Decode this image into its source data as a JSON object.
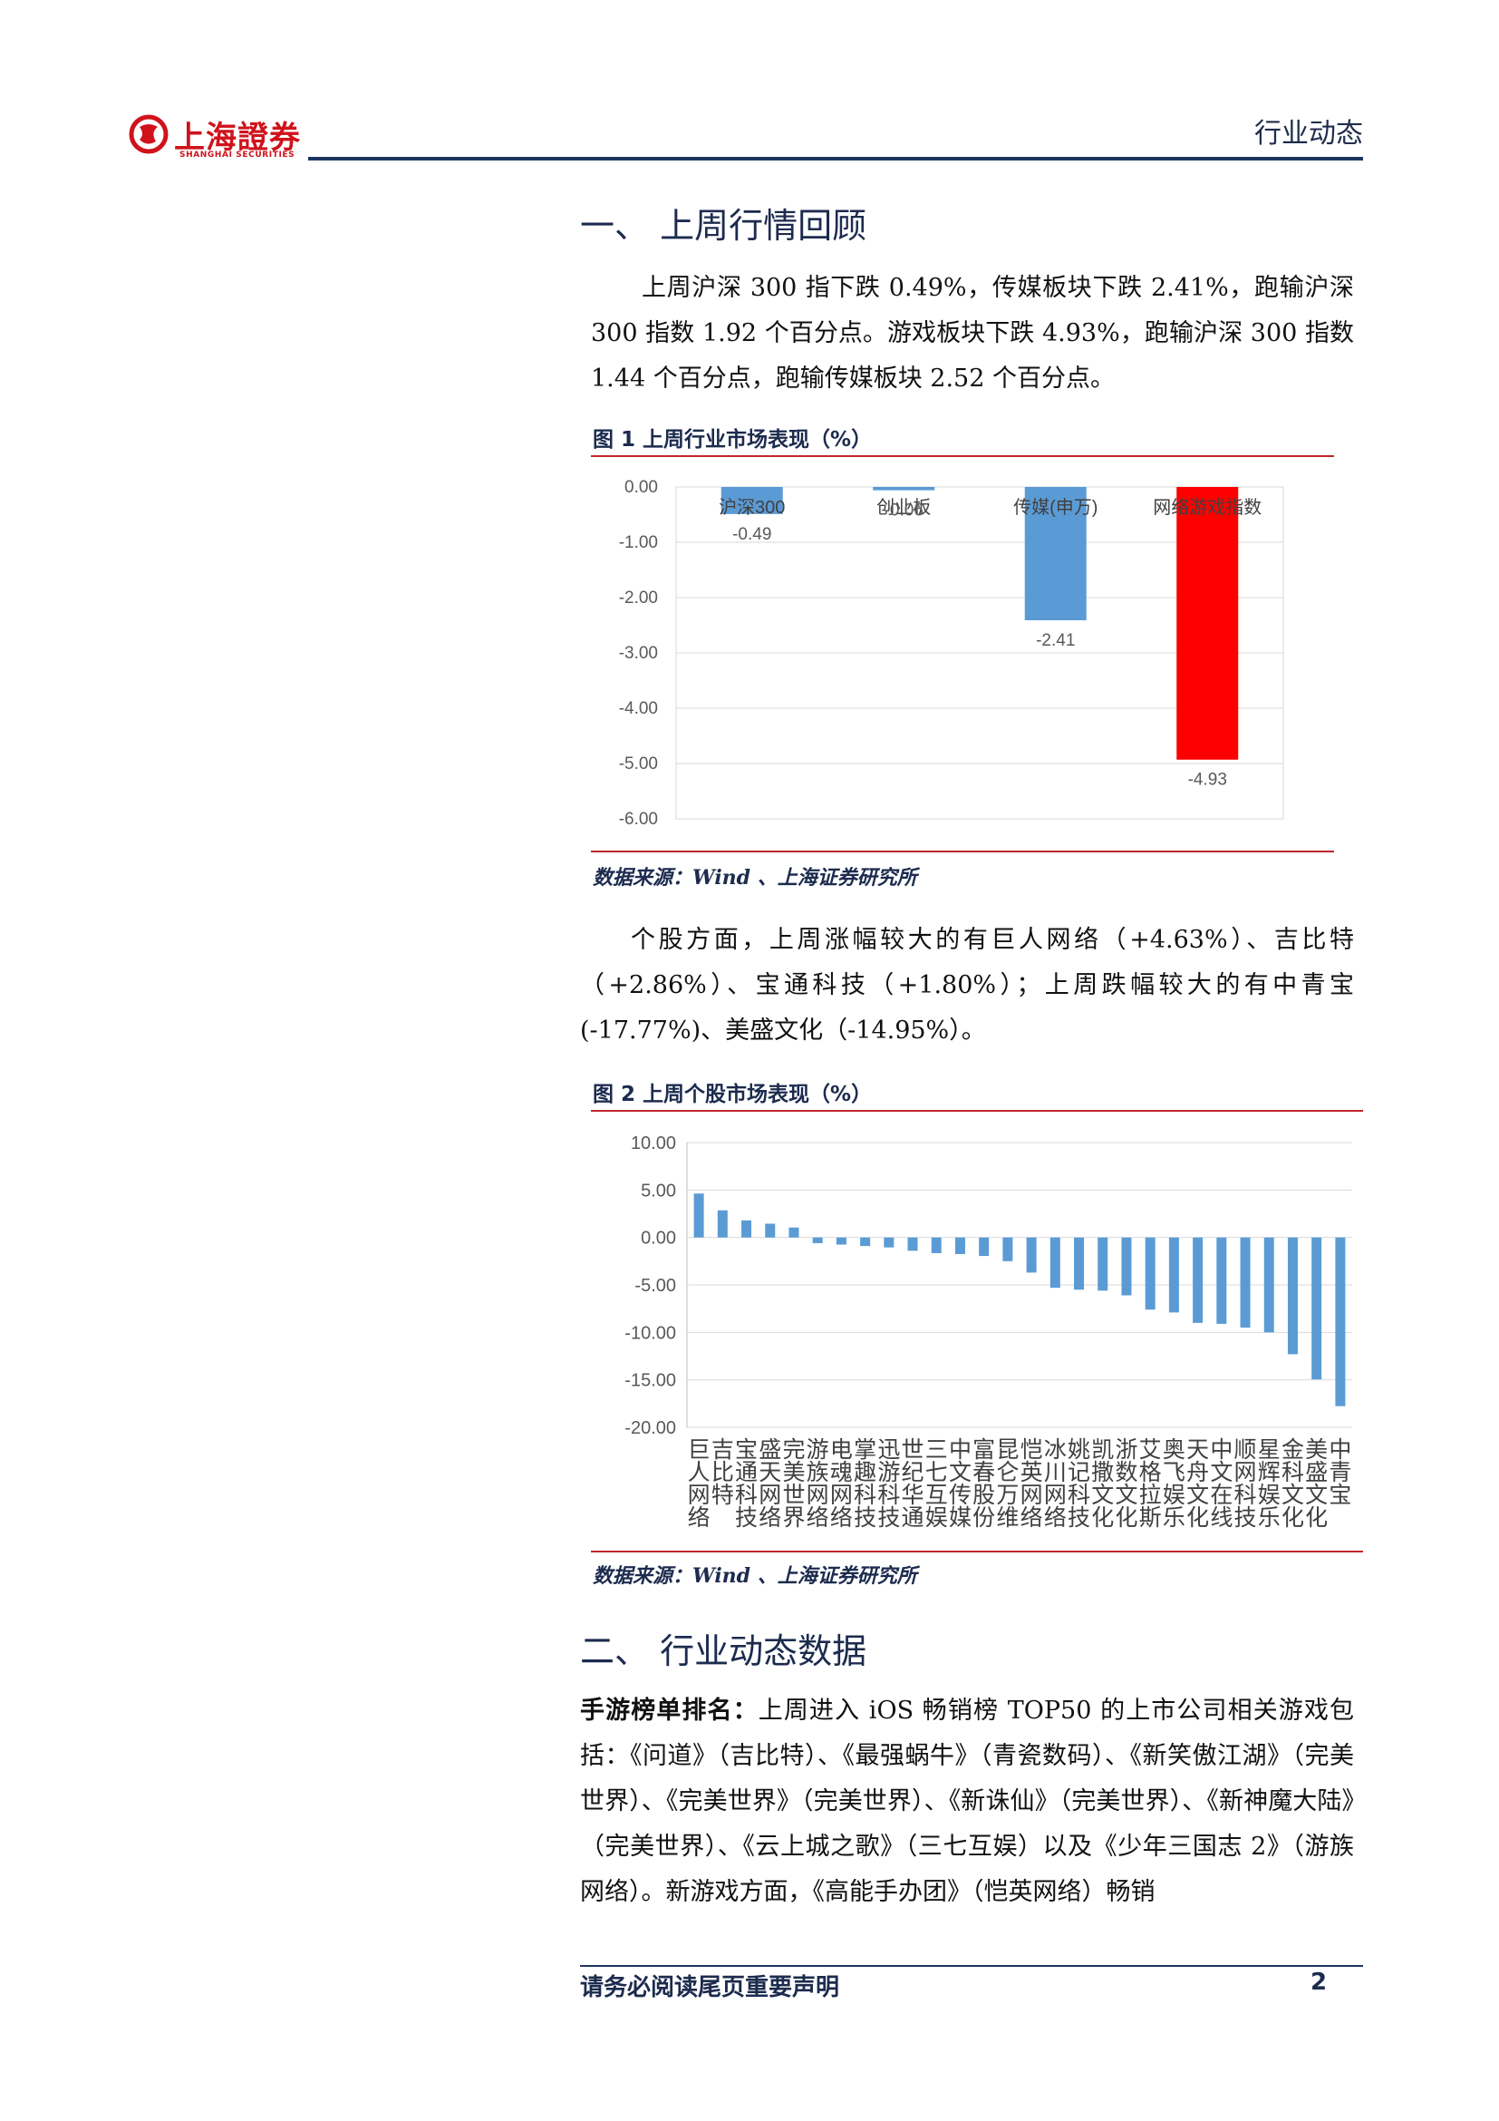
{
  "header": {
    "logo_cn": "上海證券",
    "logo_en": "SHANGHAI SECURITIES",
    "section_label": "行业动态"
  },
  "section1": {
    "title": "一、 上周行情回顾",
    "paragraph1": "上周沪深 300 指下跌 0.49%，传媒板块下跌 2.41%，跑输沪深 300 指数 1.92 个百分点。游戏板块下跌 4.93%，跑输沪深 300 指数 1.44 个百分点，跑输传媒板块 2.52 个百分点。",
    "fig1_title": "图 1 上周行业市场表现（%）",
    "fig1_source": "数据来源：Wind 、上海证券研究所",
    "paragraph2": "个股方面，上周涨幅较大的有巨人网络（+4.63%）、吉比特（+2.86%）、宝通科技（+1.80%）；上周跌幅较大的有中青宝(-17.77%)、美盛文化（-14.95%）。",
    "fig2_title": "图 2 上周个股市场表现（%）",
    "fig2_source": "数据来源：Wind 、上海证券研究所"
  },
  "section2": {
    "title": "二、 行业动态数据",
    "lead": "手游榜单排名：",
    "paragraph": "上周进入 iOS 畅销榜 TOP50 的上市公司相关游戏包括：《问道》（吉比特）、《最强蜗牛》（青瓷数码）、《新笑傲江湖》（完美世界）、《完美世界》（完美世界）、《新诛仙》（完美世界）、《新神魔大陆》（完美世界）、《云上城之歌》（三七互娱）以及《少年三国志 2》（游族网络）。新游戏方面，《高能手办团》（恺英网络）畅销"
  },
  "footer": {
    "notice": "请务必阅读尾页重要声明",
    "page_number": "2"
  },
  "chart_data": [
    {
      "type": "bar",
      "title": "",
      "categories": [
        "沪深300",
        "创业板",
        "传媒(申万)",
        "网络游戏指数"
      ],
      "values": [
        -0.49,
        -0.06,
        -2.41,
        -4.93
      ],
      "data_labels": [
        "-0.49",
        "-0.06",
        "-2.41",
        "-4.93"
      ],
      "bar_colors": [
        "#5b9bd5",
        "#5b9bd5",
        "#5b9bd5",
        "#ff0000"
      ],
      "ylim": [
        -6,
        0
      ],
      "yticks": [
        "0.00",
        "-1.00",
        "-2.00",
        "-3.00",
        "-4.00",
        "-5.00",
        "-6.00"
      ],
      "grid": true,
      "legend": "none"
    },
    {
      "type": "bar",
      "title": "",
      "categories": [
        "巨人网络",
        "吉比特",
        "宝通科技",
        "盛天网络",
        "完美世界",
        "游族网络",
        "电魂网络",
        "掌趣科技",
        "迅游科技",
        "世纪华通",
        "三七互娱",
        "中文传媒",
        "富春股份",
        "昆仑万维",
        "恺英网络",
        "冰川网络",
        "姚记科技",
        "凯撒文化",
        "浙数文化",
        "艾格拉斯",
        "奥飞娱乐",
        "天舟文化",
        "中文在线",
        "顺网科技",
        "星辉娱乐",
        "金科文化",
        "美盛文化",
        "中青宝"
      ],
      "values": [
        4.63,
        2.86,
        1.8,
        1.45,
        1.05,
        -0.6,
        -0.75,
        -0.9,
        -1.05,
        -1.4,
        -1.65,
        -1.75,
        -1.95,
        -2.5,
        -3.7,
        -5.3,
        -5.5,
        -5.6,
        -6.1,
        -7.6,
        -7.9,
        -9.0,
        -9.1,
        -9.5,
        -10.0,
        -12.3,
        -14.95,
        -17.77
      ],
      "bar_color": "#5b9bd5",
      "ylim": [
        -20,
        10
      ],
      "yticks": [
        "10.00",
        "5.00",
        "0.00",
        "-5.00",
        "-10.00",
        "-15.00",
        "-20.00"
      ],
      "grid": true,
      "legend": "none"
    }
  ]
}
